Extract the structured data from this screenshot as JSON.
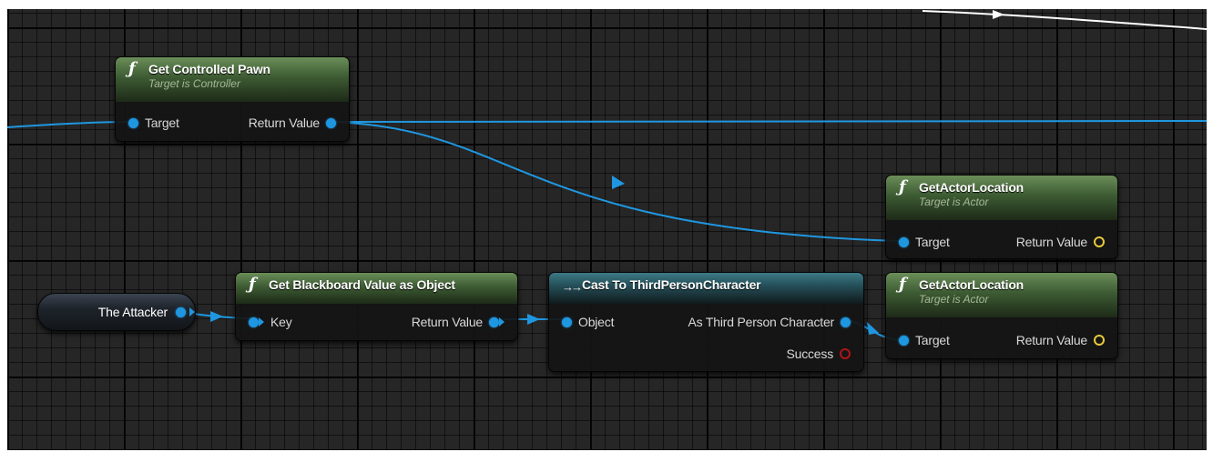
{
  "nodes": {
    "get_controlled_pawn": {
      "icon": "function-icon",
      "title": "Get Controlled Pawn",
      "subtitle": "Target is Controller",
      "pin_in": "Target",
      "pin_out": "Return Value"
    },
    "get_actor_location_1": {
      "icon": "function-icon",
      "title": "GetActorLocation",
      "subtitle": "Target is Actor",
      "pin_in": "Target",
      "pin_out": "Return Value"
    },
    "get_blackboard_value": {
      "icon": "function-icon",
      "title": "Get Blackboard Value as Object",
      "pin_in": "Key",
      "pin_out": "Return Value"
    },
    "cast_to_tpc": {
      "icon": "cast-arrow-icon",
      "title": "Cast To ThirdPersonCharacter",
      "pin_in": "Object",
      "pin_out": "As Third Person Character",
      "pin_success": "Success"
    },
    "get_actor_location_2": {
      "icon": "function-icon",
      "title": "GetActorLocation",
      "subtitle": "Target is Actor",
      "pin_in": "Target",
      "pin_out": "Return Value"
    },
    "the_attacker": {
      "label": "The Attacker"
    }
  },
  "colors": {
    "object_pin": "#1f97e0",
    "vector_pin": "#e8c93b",
    "bool_pin": "#b01414",
    "exec_wire": "#ffffff",
    "graph_bg": "#262626"
  }
}
